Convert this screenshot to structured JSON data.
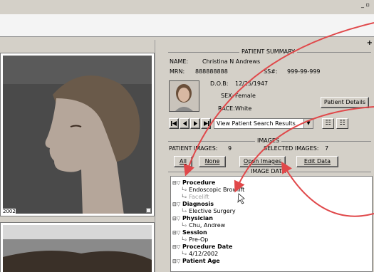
{
  "window": {
    "controls": "_ ▫"
  },
  "left": {
    "date_caption": "2002"
  },
  "patient_summary": {
    "title": "PATIENT SUMMARY",
    "name_label": "NAME:",
    "name_value": "Christina N Andrews",
    "mrn_label": "MRN:",
    "mrn_value": "888888888",
    "ssn_label": "SS#:",
    "ssn_value": "999-99-999",
    "dob_label": "D.O.B:",
    "dob_value": "12/25/1947",
    "sex_label": "SEX:",
    "sex_value": "Female",
    "race_label": "RACE:",
    "race_value": "White",
    "details_button": "Patient Details",
    "search_select": "View Patient Search Results"
  },
  "images": {
    "title": "IMAGES",
    "patient_images_label": "PATIENT IMAGES:",
    "patient_images_count": "9",
    "selected_images_label": "SELECTED IMAGES:",
    "selected_images_count": "7",
    "all_button": "All",
    "none_button": "None",
    "open_button": "Open Images",
    "edit_button": "Edit Data",
    "data_title": "IMAGE DATA"
  },
  "tree": [
    {
      "label": "Procedure",
      "bold": true
    },
    {
      "label": "Endoscopic Browlift",
      "bold": false
    },
    {
      "label": "Facelift",
      "bold": false,
      "grey": true
    },
    {
      "label": "Diagnosis",
      "bold": true
    },
    {
      "label": "Elective Surgery",
      "bold": false
    },
    {
      "label": "Physician",
      "bold": true
    },
    {
      "label": "Chu, Andrew",
      "bold": false
    },
    {
      "label": "Session",
      "bold": true
    },
    {
      "label": "Pre-Op",
      "bold": false
    },
    {
      "label": "Procedure Date",
      "bold": true
    },
    {
      "label": "4/12/2002",
      "bold": false
    },
    {
      "label": "Patient Age",
      "bold": true
    }
  ],
  "colors": {
    "annotation_arrow": "#e0484a",
    "window_bg": "#d4d0c8"
  }
}
